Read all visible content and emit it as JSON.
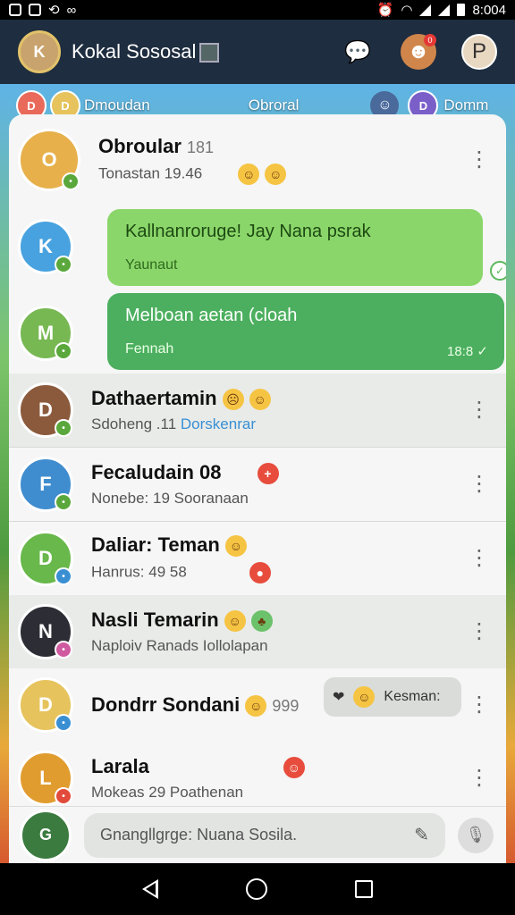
{
  "status_bar": {
    "time": "8:004"
  },
  "app_bar": {
    "title": "Kokal Sososal",
    "avatar_initial": "K",
    "notification_count": "0",
    "profile_initial": "P"
  },
  "tabs": {
    "left_label": "Dmoudan",
    "center_label": "Obroral",
    "right_label": "Domm"
  },
  "rows": [
    {
      "name": "Obroular",
      "extra": "181",
      "subtitle": "Tonastan 19.46",
      "initial": "O",
      "color": "#e7b04a"
    },
    {
      "initial": "K",
      "color": "#48a2df"
    },
    {
      "initial": "M",
      "color": "#77b853"
    },
    {
      "name": "Dathaertamin",
      "subtitle_a": "Sdoheng .11",
      "subtitle_b": "Dorskenrar",
      "initial": "D",
      "color": "#8b5a3c"
    },
    {
      "name": "Fecaludain 08",
      "subtitle": "Nonebe: 19 Sooranaan",
      "initial": "F",
      "color": "#3f8dcf"
    },
    {
      "name": "Daliar: Teman",
      "subtitle": "Hanrus: 49 58",
      "initial": "D",
      "color": "#68b84b"
    },
    {
      "name": "Nasli Temarin",
      "subtitle_a": "Naploiv",
      "subtitle_b": "Ranads",
      "subtitle_c": "Iollolapan",
      "initial": "N",
      "color": "#2d2d35"
    },
    {
      "name": "Dondrr Sondani",
      "extra": "999",
      "chip": "Kesman:",
      "initial": "D",
      "color": "#e6c35d"
    },
    {
      "name": "Larala",
      "subtitle": "Mokeas 29 Poathenan",
      "initial": "L",
      "color": "#e19c2f"
    }
  ],
  "bubbles": [
    {
      "text": "Kallnanroruge! Jay Nana psrak",
      "sub": "Yaunaut"
    },
    {
      "text": "Melboan aetan (cloah",
      "sub": "Fennah",
      "time": "18:8"
    }
  ],
  "composer": {
    "placeholder": "Gnangllgrge: Nuana Sosila.",
    "avatar_initial": "G"
  }
}
